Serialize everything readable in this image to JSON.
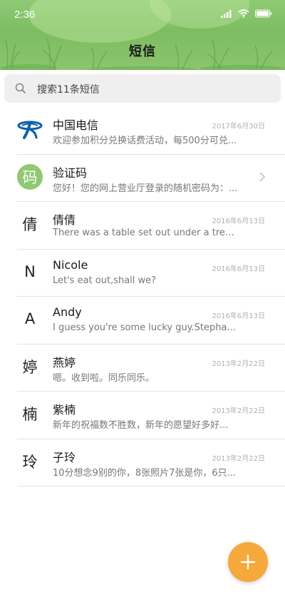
{
  "status": {
    "time": "2:36"
  },
  "header": {
    "title": "短信"
  },
  "search": {
    "placeholder": "搜索11条短信"
  },
  "conversations": [
    {
      "avatar": "logo",
      "name": "中国电信",
      "preview": "欢迎参加积分兑换话费活动，每500分可兑...",
      "date": "2017年6月30日"
    },
    {
      "avatar": "码",
      "name": "验证码",
      "preview": "您好！您的网上营业厅登录的随机密码为：...",
      "date": ""
    },
    {
      "avatar": "倩",
      "name": "倩倩",
      "preview": "There was a table set out under a tree in...",
      "date": "2016年6月13日"
    },
    {
      "avatar": "N",
      "name": "Nicole",
      "preview": "Let's eat out,shall we?",
      "date": "2016年6月13日"
    },
    {
      "avatar": "A",
      "name": "Andy",
      "preview": "I guess you're some lucky guy.Stephani...",
      "date": "2016年6月13日"
    },
    {
      "avatar": "婷",
      "name": "燕婷",
      "preview": "嗯。收到啦。同乐同乐。",
      "date": "2013年2月22日"
    },
    {
      "avatar": "楠",
      "name": "紫楠",
      "preview": "新年的祝福数不胜数，新年的愿望好多好...",
      "date": "2013年2月22日"
    },
    {
      "avatar": "玲",
      "name": "子玲",
      "preview": "10分想念9别的你，8张照片7张是你，6只...",
      "date": "2013年2月22日"
    }
  ],
  "colors": {
    "header_green": "#8fca74",
    "fab_orange": "#f4a93a",
    "avatar_green": "#8fc971"
  },
  "icons": {
    "search": "search-icon",
    "fab": "plus-icon",
    "chevron": "chevron-right-icon"
  }
}
